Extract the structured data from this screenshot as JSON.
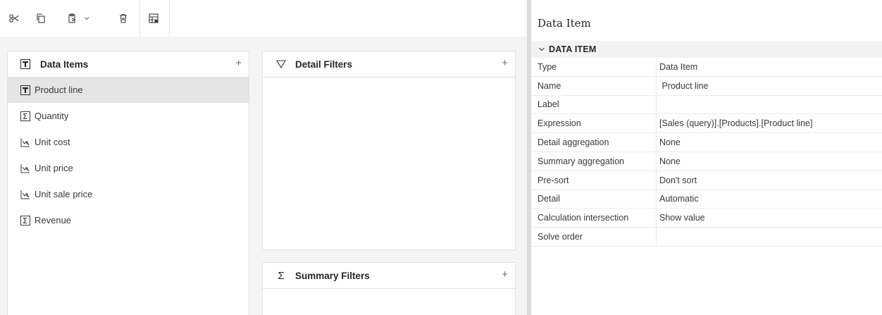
{
  "toolbar": {
    "icons": [
      "cut-icon",
      "copy-icon",
      "paste-icon",
      "chevron-down-icon",
      "delete-icon",
      "show-properties-icon"
    ]
  },
  "data_items": {
    "title": "Data Items",
    "add_label": "+",
    "items": [
      {
        "label": "Product line",
        "icon": "data-item-icon",
        "selected": true
      },
      {
        "label": "Quantity",
        "icon": "sigma-icon",
        "selected": false
      },
      {
        "label": "Unit cost",
        "icon": "measure-icon",
        "selected": false
      },
      {
        "label": "Unit price",
        "icon": "measure-icon",
        "selected": false
      },
      {
        "label": "Unit sale price",
        "icon": "measure-icon",
        "selected": false
      },
      {
        "label": "Revenue",
        "icon": "sigma-icon",
        "selected": false
      }
    ]
  },
  "detail_filters": {
    "title": "Detail Filters",
    "add_label": "+",
    "icon": "filter-icon"
  },
  "summary_filters": {
    "title": "Summary Filters",
    "add_label": "+",
    "icon": "sigma-glyph",
    "glyph": "Σ"
  },
  "properties": {
    "title": "Data Item",
    "section": "DATA ITEM",
    "rows": [
      {
        "name": "Type",
        "value": "Data Item"
      },
      {
        "name": "Name",
        "value": " Product line"
      },
      {
        "name": "Label",
        "value": ""
      },
      {
        "name": "Expression",
        "value": "[Sales (query)].[Products].[Product line]"
      },
      {
        "name": "Detail aggregation",
        "value": "None"
      },
      {
        "name": "Summary aggregation",
        "value": "None"
      },
      {
        "name": "Pre-sort",
        "value": "Don't sort"
      },
      {
        "name": "Detail",
        "value": "Automatic"
      },
      {
        "name": "Calculation intersection",
        "value": "Show value"
      },
      {
        "name": "Solve order",
        "value": ""
      }
    ]
  },
  "colors": {
    "selected_row": "#e5e5e5",
    "left_background": "#f4f4f4",
    "section_header": "#f2f2f2"
  }
}
